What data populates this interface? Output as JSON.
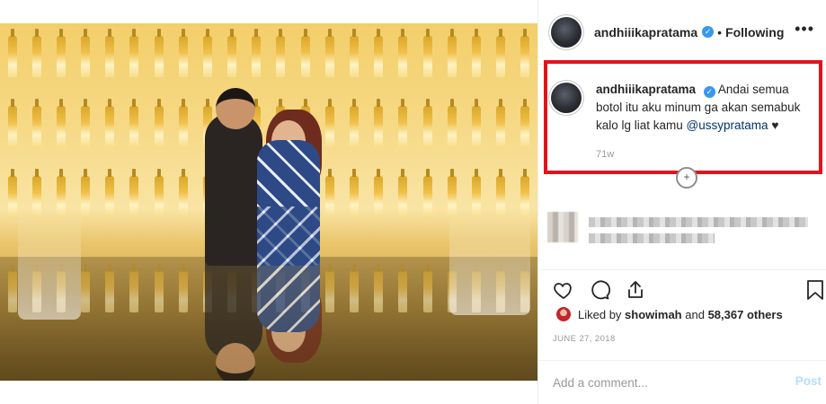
{
  "post": {
    "username": "andhiiikapratama",
    "verified_icon": "verified-badge-icon",
    "separator": "•",
    "follow_status": "Following",
    "more_label": "•••"
  },
  "caption": {
    "username": "andhiiikapratama",
    "text": "Andai semua botol itu aku minum ga akan semabuk kalo lg liat kamu ",
    "mention": "@ussypratama",
    "heart": "♥",
    "time_ago": "71w"
  },
  "actions": {
    "like_icon": "heart-icon",
    "comment_icon": "comment-icon",
    "share_icon": "share-icon",
    "save_icon": "bookmark-icon"
  },
  "likes": {
    "prefix": "Liked by ",
    "first_user": "showimah",
    "middle": " and ",
    "count": "58,367 others"
  },
  "date": "JUNE 27, 2018",
  "comment_box": {
    "placeholder": "Add a comment...",
    "post_label": "Post"
  },
  "colors": {
    "highlight_border": "#e0141b",
    "verified": "#3897f0",
    "mention": "#003569",
    "post_disabled": "#b2dffc"
  }
}
